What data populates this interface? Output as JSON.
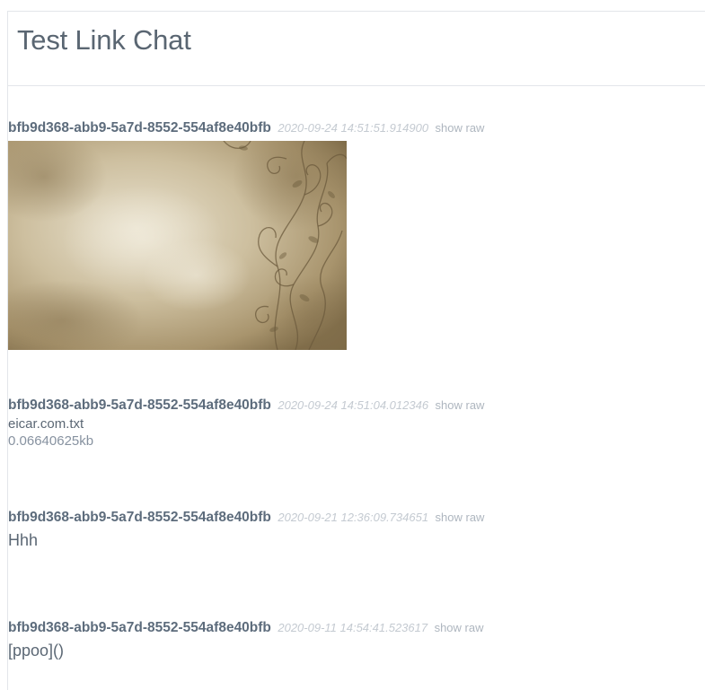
{
  "chat": {
    "title": "Test Link Chat"
  },
  "common": {
    "show_raw_label": "show raw"
  },
  "messages": [
    {
      "author": "bfb9d368-abb9-5a7d-8552-554af8e40bfb",
      "timestamp": "2020-09-24 14:51:51.914900",
      "type": "image"
    },
    {
      "author": "bfb9d368-abb9-5a7d-8552-554af8e40bfb",
      "timestamp": "2020-09-24 14:51:04.012346",
      "type": "file",
      "file_name": "eicar.com.txt",
      "file_size": "0.06640625kb"
    },
    {
      "author": "bfb9d368-abb9-5a7d-8552-554af8e40bfb",
      "timestamp": "2020-09-21 12:36:09.734651",
      "type": "text",
      "text": "Hhh"
    },
    {
      "author": "bfb9d368-abb9-5a7d-8552-554af8e40bfb",
      "timestamp": "2020-09-11 14:54:41.523617",
      "type": "text",
      "text": "[ppoo]()"
    }
  ]
}
